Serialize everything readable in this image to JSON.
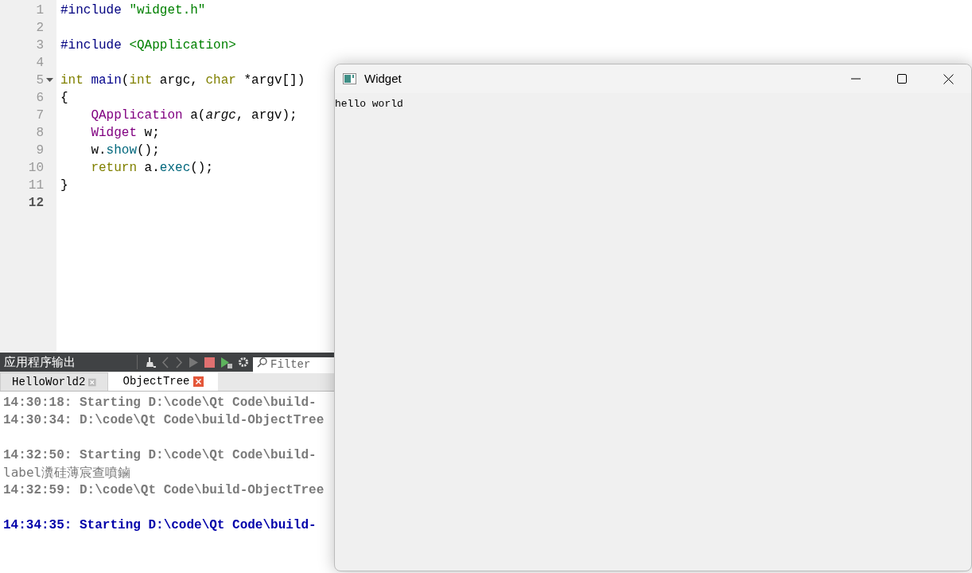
{
  "editor": {
    "lines": [
      {
        "number": "1",
        "current": false,
        "foldable": false,
        "tokens": [
          {
            "kind": "preproc",
            "text": "#include"
          },
          {
            "kind": "string",
            "text": " \"widget.h\""
          }
        ]
      },
      {
        "number": "2",
        "current": false,
        "foldable": false
      },
      {
        "number": "3",
        "current": false,
        "foldable": false,
        "tokens": [
          {
            "kind": "preproc",
            "text": "#include"
          },
          {
            "kind": "string",
            "text": " <QApplication>"
          }
        ]
      },
      {
        "number": "4",
        "current": false,
        "foldable": false
      },
      {
        "number": "5",
        "current": false,
        "foldable": true,
        "tokens": [
          {
            "kind": "keyword",
            "text": "int"
          },
          {
            "kind": "function",
            "text": " main"
          },
          {
            "kind": "plain",
            "text": "("
          },
          {
            "kind": "keyword",
            "text": "int"
          },
          {
            "kind": "plain",
            "text": " argc, "
          },
          {
            "kind": "keyword",
            "text": "char"
          },
          {
            "kind": "plain",
            "text": " *argv[])"
          }
        ]
      },
      {
        "number": "6",
        "current": false,
        "foldable": false,
        "tokens": [
          {
            "kind": "plain",
            "text": "{"
          }
        ]
      },
      {
        "number": "7",
        "current": false,
        "foldable": false,
        "tokens": [
          {
            "kind": "class",
            "text": "    QApplication"
          },
          {
            "kind": "plain",
            "text": " a("
          },
          {
            "kind": "param",
            "text": "argc"
          },
          {
            "kind": "plain",
            "text": ", argv);"
          }
        ]
      },
      {
        "number": "8",
        "current": false,
        "foldable": false,
        "tokens": [
          {
            "kind": "class",
            "text": "    Widget"
          },
          {
            "kind": "plain",
            "text": " w;"
          }
        ]
      },
      {
        "number": "9",
        "current": false,
        "foldable": false,
        "tokens": [
          {
            "kind": "plain",
            "text": "    w."
          },
          {
            "kind": "method",
            "text": "show"
          },
          {
            "kind": "plain",
            "text": "();"
          }
        ]
      },
      {
        "number": "10",
        "current": false,
        "foldable": false,
        "tokens": [
          {
            "kind": "keyword",
            "text": "    return"
          },
          {
            "kind": "plain",
            "text": " a."
          },
          {
            "kind": "method",
            "text": "exec"
          },
          {
            "kind": "plain",
            "text": "();"
          }
        ]
      },
      {
        "number": "11",
        "current": false,
        "foldable": false,
        "tokens": [
          {
            "kind": "plain",
            "text": "}"
          }
        ]
      },
      {
        "number": "12",
        "current": true,
        "foldable": false
      }
    ]
  },
  "output_pane": {
    "title": "应用程序输出",
    "filter": {
      "placeholder": "Filter"
    },
    "tabs": [
      {
        "label": "HelloWorld2",
        "selected": false
      },
      {
        "label": "ObjectTree",
        "selected": true
      }
    ],
    "lines": [
      {
        "kind": "status",
        "text": "14:30:18: Starting D:\\code\\Qt Code\\build-"
      },
      {
        "kind": "status",
        "text": "14:30:34: D:\\code\\Qt Code\\build-ObjectTree"
      },
      {
        "kind": "blank"
      },
      {
        "kind": "status",
        "text": "14:32:50: Starting D:\\code\\Qt Code\\build-"
      },
      {
        "kind": "stdout",
        "text": "label瀵硅薄宸查噴鏀"
      },
      {
        "kind": "status",
        "text": "14:32:59: D:\\code\\Qt Code\\build-ObjectTree"
      },
      {
        "kind": "blank"
      },
      {
        "kind": "current",
        "text": "14:34:35: Starting D:\\code\\Qt Code\\build-"
      }
    ]
  },
  "widget_window": {
    "title": "Widget",
    "label": "hello world"
  }
}
